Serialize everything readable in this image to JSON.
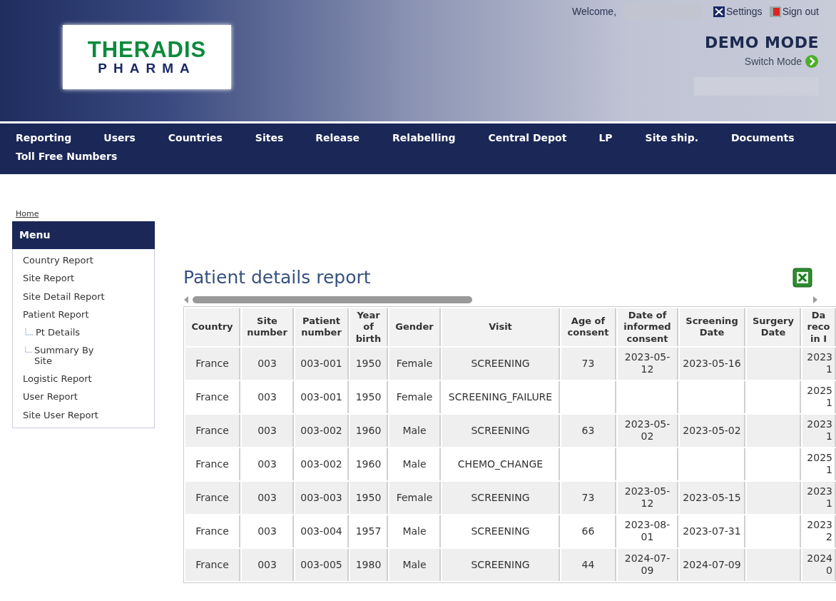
{
  "header": {
    "logo": {
      "line_1": "THERADIS",
      "line_2": "PHARMA"
    },
    "welcome": "Welcome,",
    "links": [
      {
        "label": "Settings",
        "kind": "settings"
      },
      {
        "label": "Sign out",
        "kind": "signout"
      }
    ],
    "mode": "DEMO MODE",
    "switch_mode": "Switch Mode"
  },
  "nav": [
    "Reporting",
    "Users",
    "Countries",
    "Sites",
    "Release",
    "Relabelling",
    "Central Depot",
    "LP",
    "Site ship.",
    "Documents",
    "Toll Free Numbers"
  ],
  "breadcrumb": "Home",
  "sidebar": {
    "title": "Menu",
    "items": [
      {
        "label": "Country Report",
        "kind": "item"
      },
      {
        "label": "Site Report",
        "kind": "item"
      },
      {
        "label": "Site Detail Report",
        "kind": "item"
      },
      {
        "label": "Patient Report",
        "kind": "item"
      },
      {
        "label": "Pt Details",
        "kind": "sub"
      },
      {
        "label": "Summary By Site",
        "kind": "sub"
      },
      {
        "label": "Logistic Report",
        "kind": "item"
      },
      {
        "label": "User Report",
        "kind": "item"
      },
      {
        "label": "Site User Report",
        "kind": "item"
      }
    ]
  },
  "report": {
    "title": "Patient details report",
    "columns": [
      "Country",
      "Site number",
      "Patient number",
      "Year of birth",
      "Gender",
      "Visit",
      "Age of consent",
      "Date of informed consent",
      "Screening Date",
      "Surgery Date",
      "Da reco in I"
    ],
    "rows": [
      [
        "France",
        "003",
        "003-001",
        "1950",
        "Female",
        "SCREENING",
        "73",
        "2023-05-12",
        "2023-05-16",
        "",
        "2023 1"
      ],
      [
        "France",
        "003",
        "003-001",
        "1950",
        "Female",
        "SCREENING_FAILURE",
        "",
        "",
        "",
        "",
        "2025 1"
      ],
      [
        "France",
        "003",
        "003-002",
        "1960",
        "Male",
        "SCREENING",
        "63",
        "2023-05-02",
        "2023-05-02",
        "",
        "2023 1"
      ],
      [
        "France",
        "003",
        "003-002",
        "1960",
        "Male",
        "CHEMO_CHANGE",
        "",
        "",
        "",
        "",
        "2025 1"
      ],
      [
        "France",
        "003",
        "003-003",
        "1950",
        "Female",
        "SCREENING",
        "73",
        "2023-05-12",
        "2023-05-15",
        "",
        "2023 1"
      ],
      [
        "France",
        "003",
        "003-004",
        "1957",
        "Male",
        "SCREENING",
        "66",
        "2023-08-01",
        "2023-07-31",
        "",
        "2023 2"
      ],
      [
        "France",
        "003",
        "003-005",
        "1980",
        "Male",
        "SCREENING",
        "44",
        "2024-07-09",
        "2024-07-09",
        "",
        "2024 0"
      ]
    ]
  }
}
